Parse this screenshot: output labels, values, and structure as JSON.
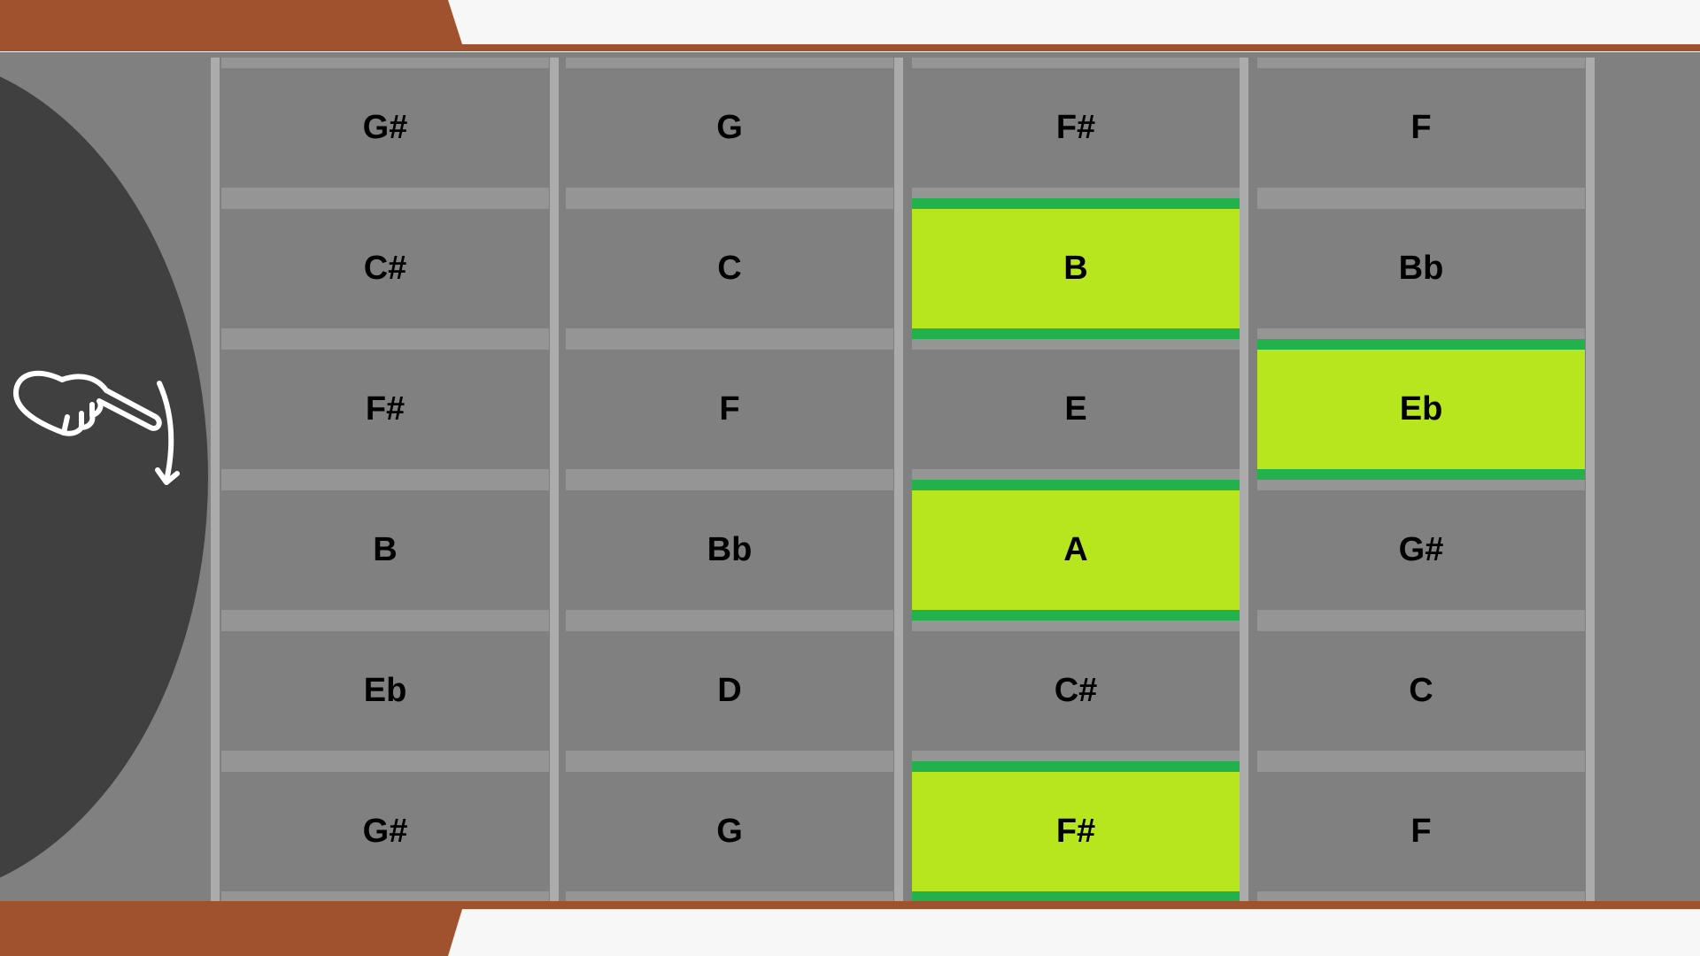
{
  "colors": {
    "wood": "#a0512d",
    "board": "#808080",
    "wheel": "#404040",
    "highlight": "#b7e61f",
    "highlight_edge": "#22b14c"
  },
  "gesture_icon": "swipe-down-hand-icon",
  "strings": [
    {
      "notes": [
        "G#",
        "C#",
        "F#",
        "B",
        "Eb",
        "G#"
      ],
      "highlighted": []
    },
    {
      "notes": [
        "G",
        "C",
        "F",
        "Bb",
        "D",
        "G"
      ],
      "highlighted": []
    },
    {
      "notes": [
        "F#",
        "B",
        "E",
        "A",
        "C#",
        "F#"
      ],
      "highlighted": [
        1,
        3,
        5
      ]
    },
    {
      "notes": [
        "F",
        "Bb",
        "Eb",
        "G#",
        "C",
        "F"
      ],
      "highlighted": [
        2
      ]
    }
  ]
}
